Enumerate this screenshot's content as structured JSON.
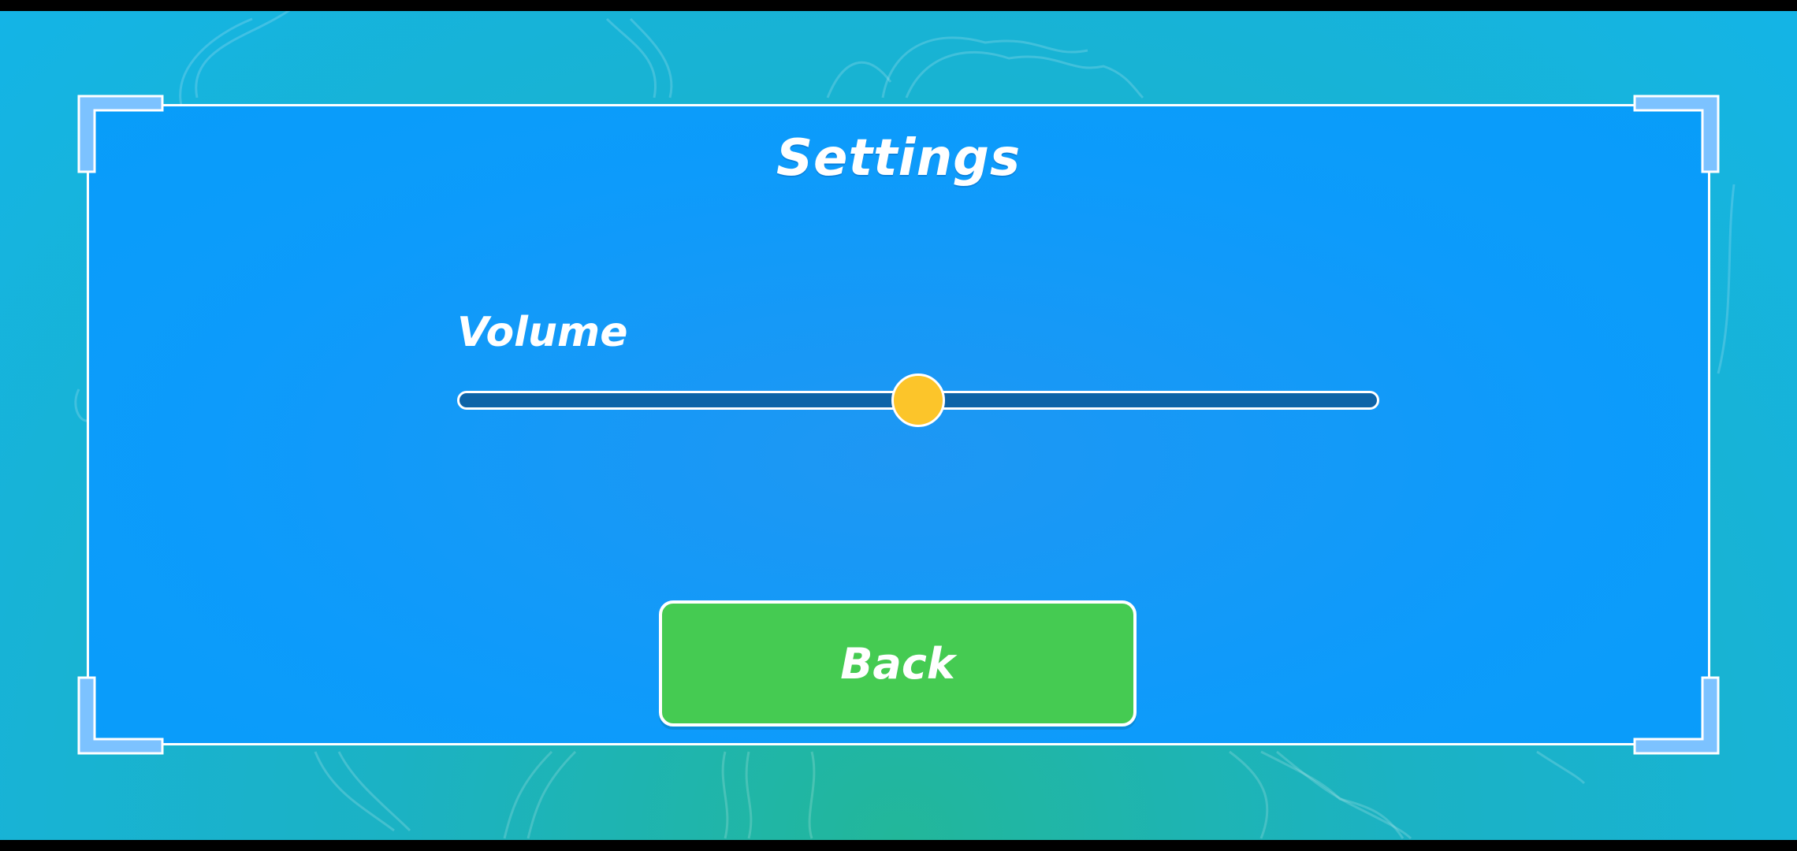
{
  "settings": {
    "title": "Settings",
    "volume_label": "Volume",
    "volume_level": 0.5,
    "back_label": "Back"
  },
  "colors": {
    "panel": "#0d9bfb",
    "accent_thumb": "#fcc52a",
    "track": "#0d64a8",
    "button": "#45cb52",
    "corner_bracket": "#7cc2ff"
  }
}
